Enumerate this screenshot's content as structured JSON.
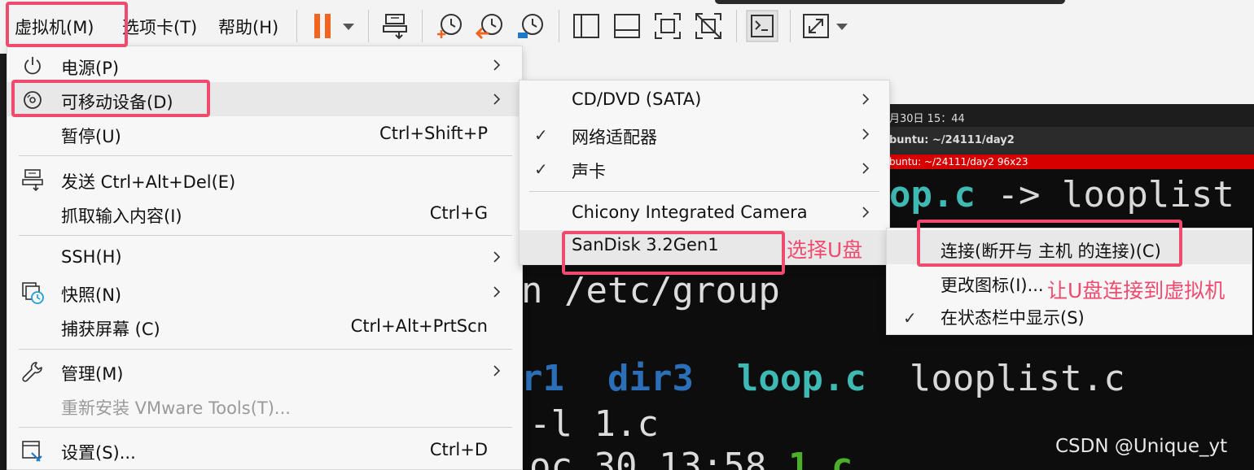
{
  "menubar": {
    "vm": "虚拟机(M)",
    "tabs": "选项卡(T)",
    "help": "帮助(H)"
  },
  "main_menu": {
    "power": {
      "label": "电源(P)"
    },
    "removable": {
      "label": "可移动设备(D)"
    },
    "pause": {
      "label": "暂停(U)",
      "shortcut": "Ctrl+Shift+P"
    },
    "send_cad": {
      "label": "发送 Ctrl+Alt+Del(E)"
    },
    "grab_input": {
      "label": "抓取输入内容(I)",
      "shortcut": "Ctrl+G"
    },
    "ssh": {
      "label": "SSH(H)"
    },
    "snapshot": {
      "label": "快照(N)"
    },
    "capture_screen": {
      "label": "捕获屏幕 (C)",
      "shortcut": "Ctrl+Alt+PrtScn"
    },
    "manage": {
      "label": "管理(M)"
    },
    "reinstall_tools": {
      "label": "重新安装 VMware Tools(T)..."
    },
    "settings": {
      "label": "设置(S)...",
      "shortcut": "Ctrl+D"
    }
  },
  "device_menu": {
    "cddvd": "CD/DVD (SATA)",
    "network": "网络适配器",
    "sound": "声卡",
    "camera": "Chicony Integrated Camera",
    "sandisk": "SanDisk 3.2Gen1"
  },
  "usb_menu": {
    "connect": "连接(断开与 主机 的连接)(C)",
    "change_icon": "更改图标(I)...",
    "show_in_statusbar": "在状态栏中显示(S)"
  },
  "annotations": {
    "select_usb": "选择U盘",
    "connect_usb": "让U盘连接到虚拟机"
  },
  "terminal": {
    "topbar_clock": "月30日  15：44",
    "title": "buntu: ~/24111/day2",
    "subtitle": "buntu: ~/24111/day2 96x23",
    "line1_a": "op.c",
    "line1_b": " -> looplist",
    "line2": "n /etc/group",
    "line3_a": "r1",
    "line3_b": "dir3",
    "line3_c": "loop.c",
    "line3_d": "looplist.c",
    "line4": "-l 1.c",
    "line5_a": "oc 30 13:58 ",
    "line5_b": "1.c"
  },
  "watermark": "CSDN @Unique_yt",
  "colors": {
    "annotation": "#ef4b6e",
    "pause_icon": "#f2651f",
    "menu_bg": "#f7f7f7"
  }
}
